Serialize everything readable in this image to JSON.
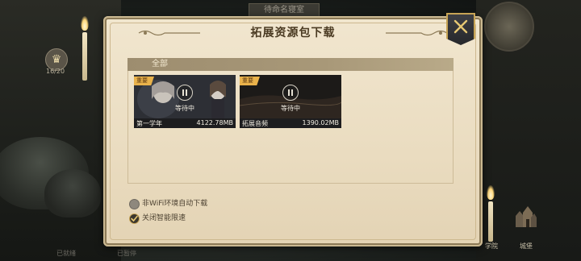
{
  "scene": {
    "room_title": "待命名寝室",
    "badge_count": "16/20",
    "bottom_left_status": "已就绪",
    "bottom_mid_status": "已暂停",
    "house_label": "学院",
    "building_label": "城堡"
  },
  "dialog": {
    "title": "拓展资源包下载",
    "close_icon": "close-x-icon",
    "section_label": "全部",
    "packs": [
      {
        "tag": "重要",
        "state": "等待中",
        "name": "第一学年",
        "size": "4122.78MB"
      },
      {
        "tag": "重要",
        "state": "等待中",
        "name": "拓展音频",
        "size": "1390.02MB"
      }
    ],
    "options": [
      {
        "label": "非WiFi环境自动下载",
        "checked": false
      },
      {
        "label": "关闭智能限速",
        "checked": true
      }
    ]
  },
  "colors": {
    "parchment": "#eadcc0",
    "accent_gold": "#c7a455",
    "tag_gold": "#e9b24b",
    "section_bar": "#a89878"
  }
}
